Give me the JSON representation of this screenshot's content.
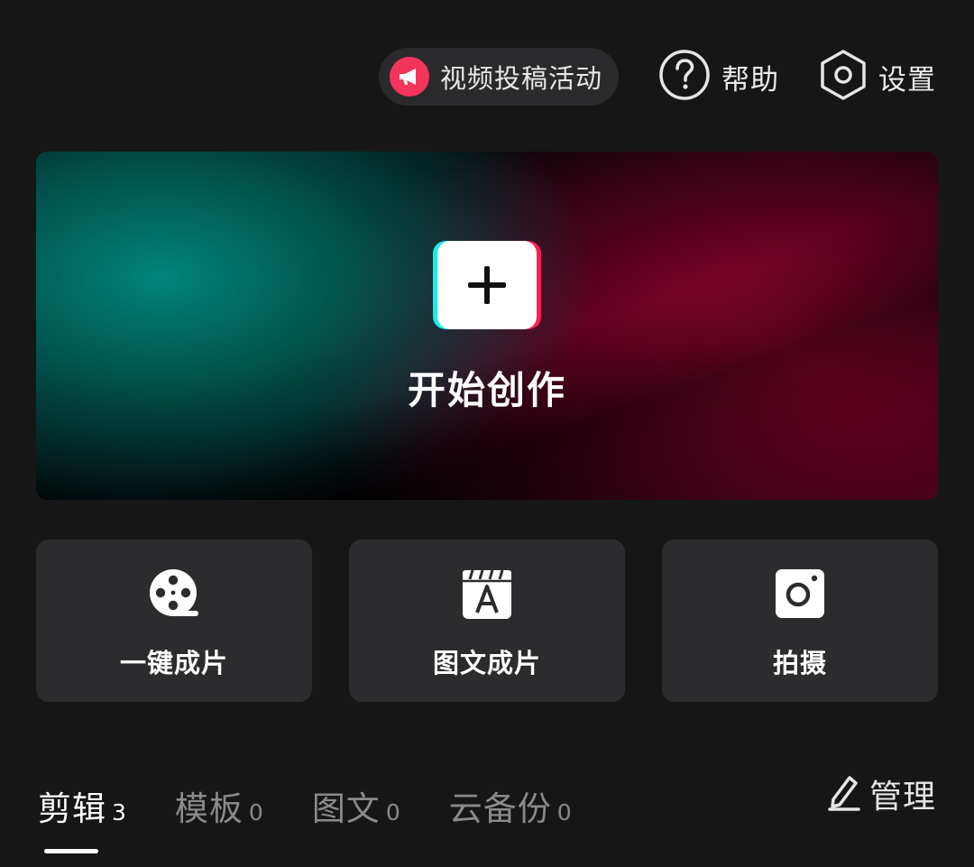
{
  "topbar": {
    "promo": {
      "label": "视频投稿活动",
      "icon": "megaphone-icon"
    },
    "help": {
      "label": "帮助",
      "icon": "help-circle-icon"
    },
    "settings": {
      "label": "设置",
      "icon": "hexagon-settings-icon"
    }
  },
  "hero": {
    "title": "开始创作",
    "icon": "plus-icon"
  },
  "quick_actions": [
    {
      "label": "一键成片",
      "icon": "film-reel-icon"
    },
    {
      "label": "图文成片",
      "icon": "text-clapper-icon"
    },
    {
      "label": "拍摄",
      "icon": "camera-icon"
    }
  ],
  "tabs": [
    {
      "label": "剪辑",
      "count": "3",
      "active": true
    },
    {
      "label": "模板",
      "count": "0",
      "active": false
    },
    {
      "label": "图文",
      "count": "0",
      "active": false
    },
    {
      "label": "云备份",
      "count": "0",
      "active": false
    }
  ],
  "manage": {
    "label": "管理",
    "icon": "edit-pencil-icon"
  },
  "colors": {
    "background": "#161617",
    "card": "#2c2c2e",
    "promo_red": "#f2355a",
    "teal": "#008b81",
    "crimson": "#b00638",
    "inactive_text": "#8a8a8c"
  }
}
